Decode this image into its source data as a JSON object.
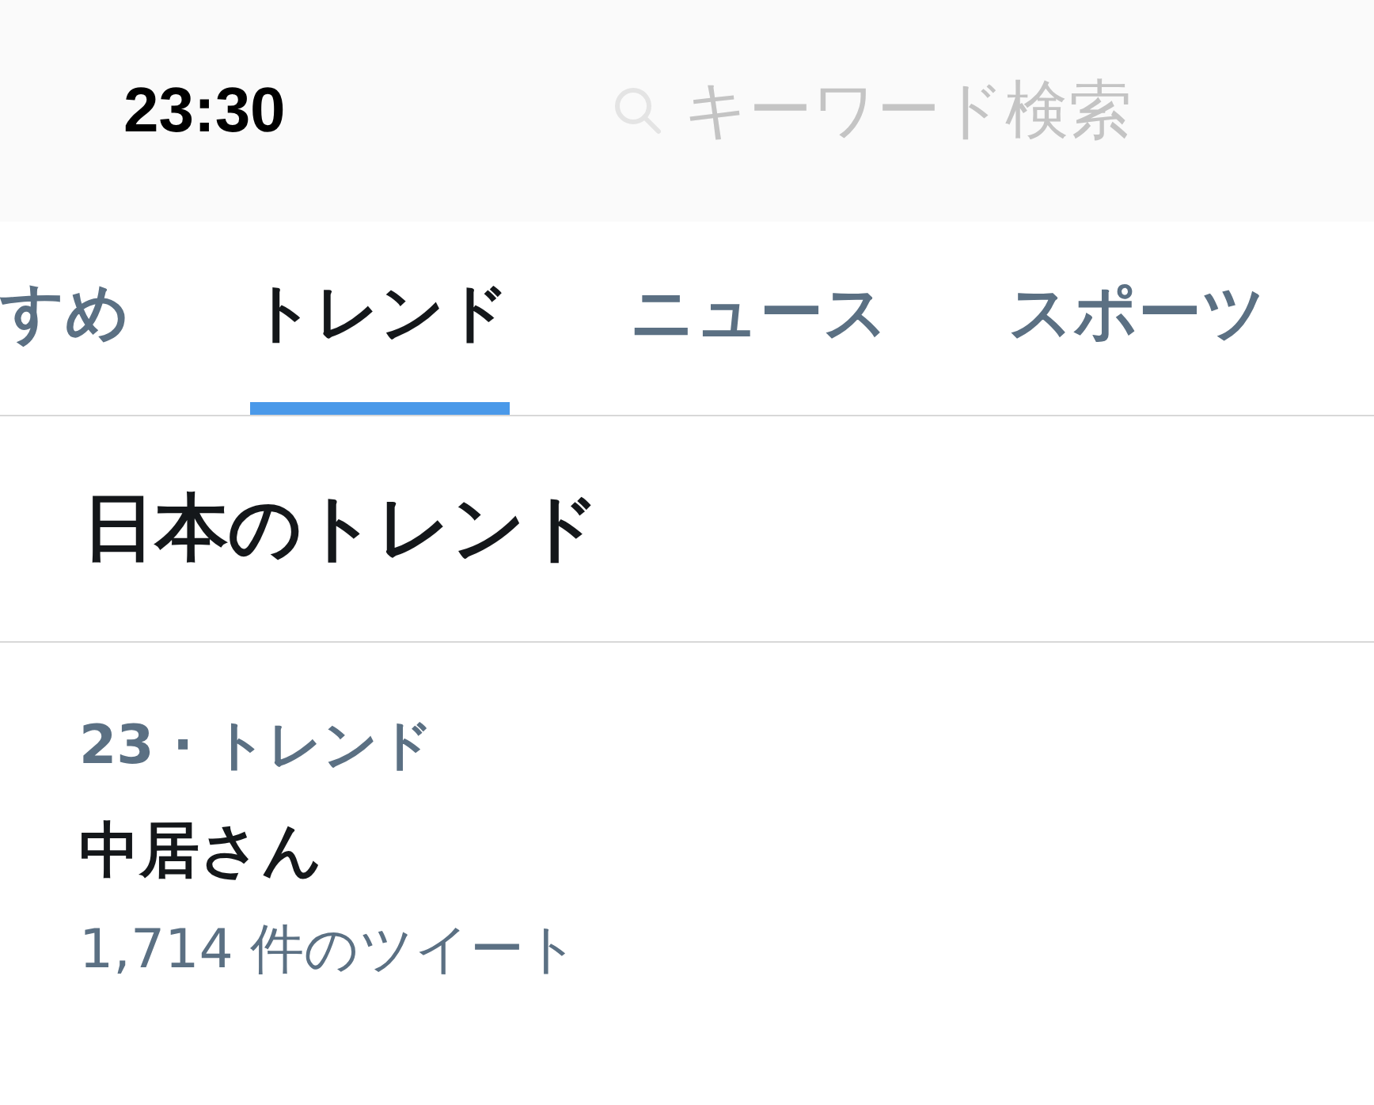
{
  "status_bar": {
    "time": "23:30"
  },
  "search": {
    "placeholder": "キーワード検索"
  },
  "tabs": [
    {
      "label": "すめ",
      "selected": false
    },
    {
      "label": "トレンド",
      "selected": true
    },
    {
      "label": "ニュース",
      "selected": false
    },
    {
      "label": "スポーツ",
      "selected": false
    }
  ],
  "section": {
    "title": "日本のトレンド"
  },
  "trends": [
    {
      "rank_line": "23 · トレンド",
      "name": "中居さん",
      "count": "1,714 件のツイート"
    }
  ]
}
